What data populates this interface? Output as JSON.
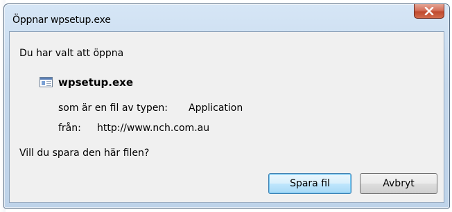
{
  "dialog": {
    "title": "Öppnar wpsetup.exe",
    "lead_text": "Du har valt att öppna",
    "file": {
      "icon": "application-file-icon",
      "name": "wpsetup.exe",
      "type_label": "som är en fil av typen:",
      "type_value": "Application",
      "from_label": "från:",
      "from_value": "http://www.nch.com.au"
    },
    "question": "Vill du spara den här filen?",
    "buttons": {
      "save_label": "Spara fil",
      "cancel_label": "Avbryt"
    },
    "close_icon": "close-icon"
  }
}
